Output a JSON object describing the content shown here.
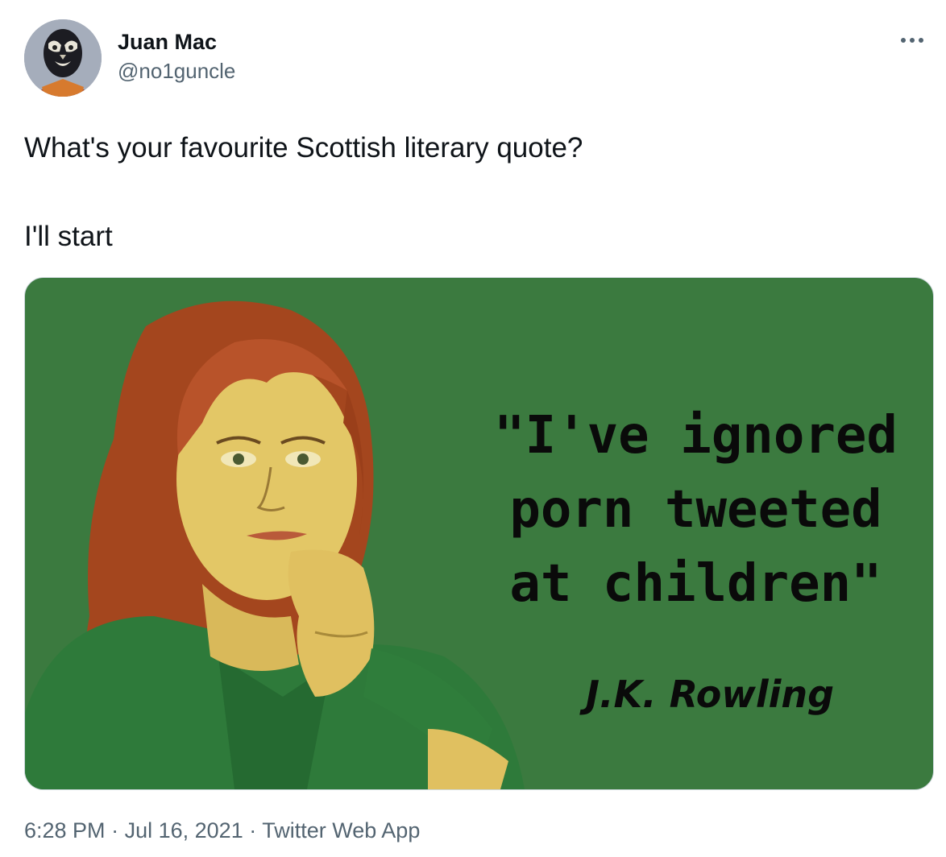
{
  "author": {
    "display_name": "Juan Mac",
    "handle": "@no1guncle"
  },
  "more_icon": "more-horizontal-icon",
  "tweet": {
    "line1": "What's your favourite Scottish literary quote?",
    "line2": "I'll start"
  },
  "media": {
    "quote_line1": "\"I've ignored",
    "quote_line2": "porn tweeted",
    "quote_line3": "at children\"",
    "attribution": "J.K. Rowling",
    "background_color": "#3b7a3f"
  },
  "meta": {
    "time": "6:28 PM",
    "separator": "·",
    "date": "Jul 16, 2021",
    "source": "Twitter Web App"
  },
  "colors": {
    "text_primary": "#0f1419",
    "text_secondary": "#536471",
    "border": "#cfd9de"
  }
}
